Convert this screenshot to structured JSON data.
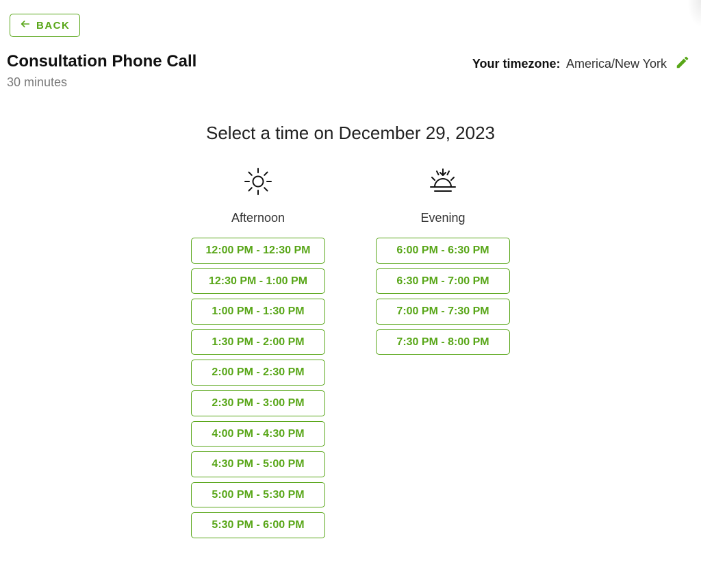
{
  "back_label": "BACK",
  "title": "Consultation Phone Call",
  "duration": "30 minutes",
  "timezone": {
    "label": "Your timezone:",
    "value": "America/New York"
  },
  "prompt": "Select a time on December 29, 2023",
  "columns": {
    "afternoon": {
      "label": "Afternoon",
      "slots": [
        "12:00 PM - 12:30 PM",
        "12:30 PM - 1:00 PM",
        "1:00 PM - 1:30 PM",
        "1:30 PM - 2:00 PM",
        "2:00 PM - 2:30 PM",
        "2:30 PM - 3:00 PM",
        "4:00 PM - 4:30 PM",
        "4:30 PM - 5:00 PM",
        "5:00 PM - 5:30 PM",
        "5:30 PM - 6:00 PM"
      ]
    },
    "evening": {
      "label": "Evening",
      "slots": [
        "6:00 PM - 6:30 PM",
        "6:30 PM - 7:00 PM",
        "7:00 PM - 7:30 PM",
        "7:30 PM - 8:00 PM"
      ]
    }
  },
  "accent_color": "#58a618"
}
